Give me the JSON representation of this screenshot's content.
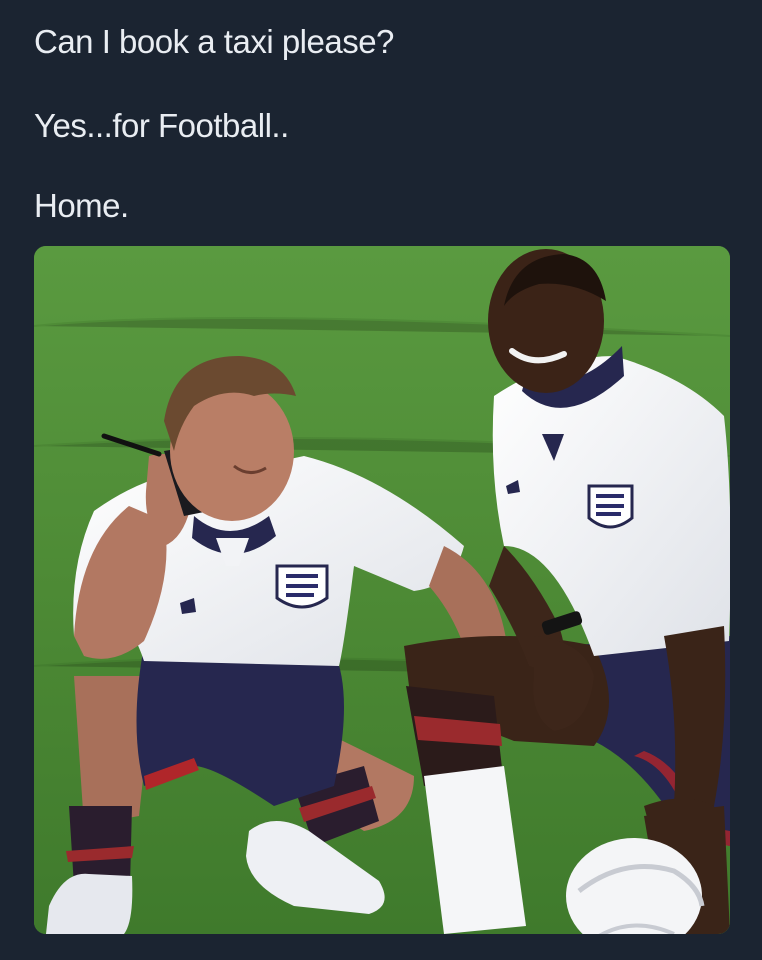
{
  "post": {
    "caption_lines": [
      "Can I book a taxi please?",
      "Yes...for Football..",
      "Home."
    ]
  },
  "photo": {
    "subject": "two players in white and navy kits crouching on a grass pitch, one talking on a mobile phone, ball at right",
    "colors": {
      "grass": "#4f8a37",
      "kit_white": "#f2f3f6",
      "kit_navy": "#26274f",
      "kit_red": "#b0262a",
      "background": "#1b2431",
      "caption_text": "#e9edf2"
    }
  }
}
